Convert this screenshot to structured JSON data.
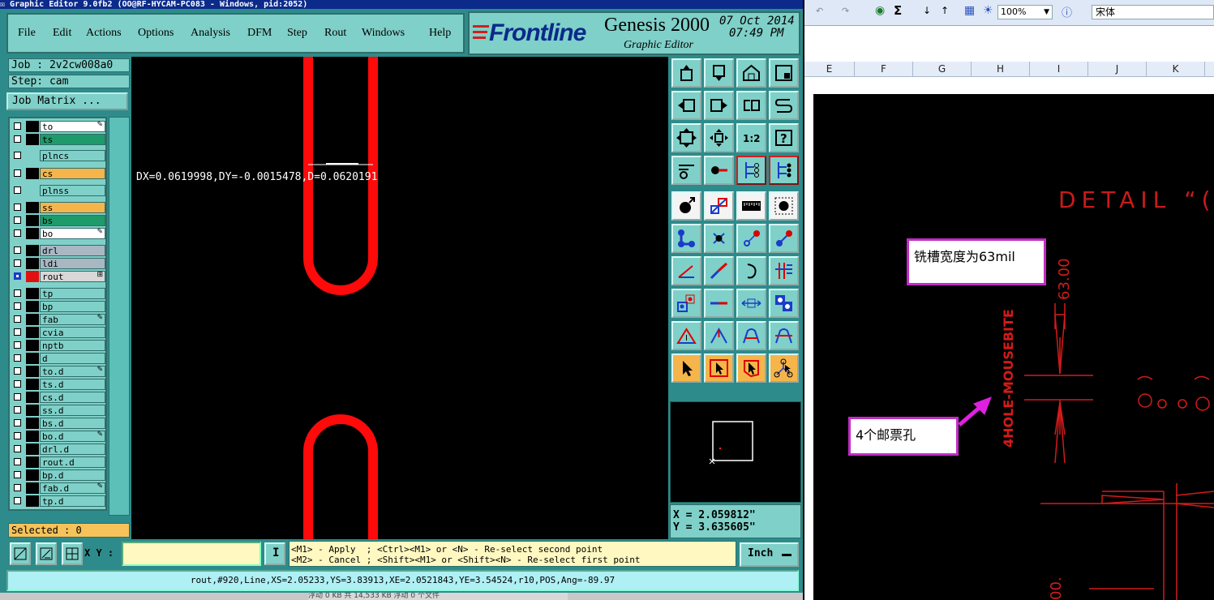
{
  "window_title": "Graphic Editor 9.0fb2 (OO@RF-HYCAM-PC083 - Windows, pid:2052)",
  "menu": [
    "File",
    "Edit",
    "Actions",
    "Options",
    "Analysis",
    "DFM",
    "Step",
    "Rout",
    "Windows",
    "Help"
  ],
  "logo": {
    "brand": "Frontline",
    "product": "Genesis 2000",
    "subtitle": "Graphic Editor",
    "date": "07 Oct 2014",
    "time": "07:49 PM"
  },
  "job": {
    "job_label": "Job : 2v2cw008a0",
    "step_label": "Step: cam",
    "matrix_button": "Job Matrix ..."
  },
  "layers": [
    {
      "name": "to",
      "bg": "#ffffff",
      "color": "#000000",
      "mark": "✎",
      "checked": false
    },
    {
      "name": "ts",
      "bg": "#1f9a6a",
      "color": "#000000",
      "mark": "",
      "checked": false
    },
    {
      "name": "plncs",
      "bg": "#7fd0c8",
      "color": "#7fd0c8",
      "mark": "",
      "checked": false
    },
    {
      "name": "cs",
      "bg": "#f6b54a",
      "color": "#000000",
      "mark": "",
      "checked": false
    },
    {
      "name": "plnss",
      "bg": "#7fd0c8",
      "color": "#7fd0c8",
      "mark": "",
      "checked": false
    },
    {
      "name": "ss",
      "bg": "#f6b54a",
      "color": "#000000",
      "mark": "",
      "checked": false
    },
    {
      "name": "bs",
      "bg": "#1f9a6a",
      "color": "#000000",
      "mark": "",
      "checked": false
    },
    {
      "name": "bo",
      "bg": "#ffffff",
      "color": "#000000",
      "mark": "✎",
      "checked": false
    },
    {
      "name": "drl",
      "bg": "#a9b7c2",
      "color": "#000000",
      "mark": "",
      "checked": false
    },
    {
      "name": "ldi",
      "bg": "#a9b7c2",
      "color": "#000000",
      "mark": "",
      "checked": false
    },
    {
      "name": "rout",
      "bg": "#d8d8d8",
      "color": "#e01010",
      "mark": "⊞",
      "checked": true
    },
    {
      "name": "tp",
      "bg": "#7fd0c8",
      "color": "#000000",
      "mark": "",
      "checked": false
    },
    {
      "name": "bp",
      "bg": "#7fd0c8",
      "color": "#000000",
      "mark": "",
      "checked": false
    },
    {
      "name": "fab",
      "bg": "#7fd0c8",
      "color": "#000000",
      "mark": "✎",
      "checked": false
    },
    {
      "name": "cvia",
      "bg": "#7fd0c8",
      "color": "#000000",
      "mark": "",
      "checked": false
    },
    {
      "name": "nptb",
      "bg": "#7fd0c8",
      "color": "#000000",
      "mark": "",
      "checked": false
    },
    {
      "name": "d",
      "bg": "#7fd0c8",
      "color": "#000000",
      "mark": "",
      "checked": false
    },
    {
      "name": "to.d",
      "bg": "#7fd0c8",
      "color": "#000000",
      "mark": "✎",
      "checked": false
    },
    {
      "name": "ts.d",
      "bg": "#7fd0c8",
      "color": "#000000",
      "mark": "",
      "checked": false
    },
    {
      "name": "cs.d",
      "bg": "#7fd0c8",
      "color": "#000000",
      "mark": "",
      "checked": false
    },
    {
      "name": "ss.d",
      "bg": "#7fd0c8",
      "color": "#000000",
      "mark": "",
      "checked": false
    },
    {
      "name": "bs.d",
      "bg": "#7fd0c8",
      "color": "#000000",
      "mark": "",
      "checked": false
    },
    {
      "name": "bo.d",
      "bg": "#7fd0c8",
      "color": "#000000",
      "mark": "✎",
      "checked": false
    },
    {
      "name": "drl.d",
      "bg": "#7fd0c8",
      "color": "#000000",
      "mark": "",
      "checked": false
    },
    {
      "name": "rout.d",
      "bg": "#7fd0c8",
      "color": "#000000",
      "mark": "",
      "checked": false
    },
    {
      "name": "bp.d",
      "bg": "#7fd0c8",
      "color": "#000000",
      "mark": "",
      "checked": false
    },
    {
      "name": "fab.d",
      "bg": "#7fd0c8",
      "color": "#000000",
      "mark": "✎",
      "checked": false
    },
    {
      "name": "tp.d",
      "bg": "#7fd0c8",
      "color": "#000000",
      "mark": "",
      "checked": false
    }
  ],
  "selected_label": "Selected : 0",
  "measurement": "DX=0.0619998,DY=-0.0015478,D=0.0620191",
  "coords": {
    "x": "X = 2.059812\"",
    "y": "Y = 3.635605\""
  },
  "xy_label": "X Y :",
  "xy_input_value": "",
  "info_button": "I",
  "hint_lines": [
    "<M1> - Apply  ; <Ctrl><M1> or <N> - Re-select second point",
    "<M2> - Cancel ; <Shift><M1> or <Shift><N> - Re-select first point"
  ],
  "units": "Inch",
  "status": "rout,#920,Line,XS=2.05233,YS=3.83913,XE=2.0521843,YE=3.54524,r10,POS,Ang=-89.97",
  "ime_bar": "浮动 0 KB  共 14,533 KB  浮动 0 个文件",
  "excel": {
    "zoom": "100%",
    "font": "宋体",
    "sigma": "Σ",
    "columns": [
      "E",
      "F",
      "G",
      "H",
      "I",
      "J",
      "K"
    ],
    "detail_text": "DETAIL “(",
    "callout_width": "铣槽宽度为63mil",
    "callout_holes": "4个邮票孔",
    "dim_63": "63.00",
    "mousebite": "4HOLE-MOUSEBITE",
    "dim_bottom": "00.",
    "accent": "#c22cc6",
    "drawing_color": "#d41a1a"
  }
}
